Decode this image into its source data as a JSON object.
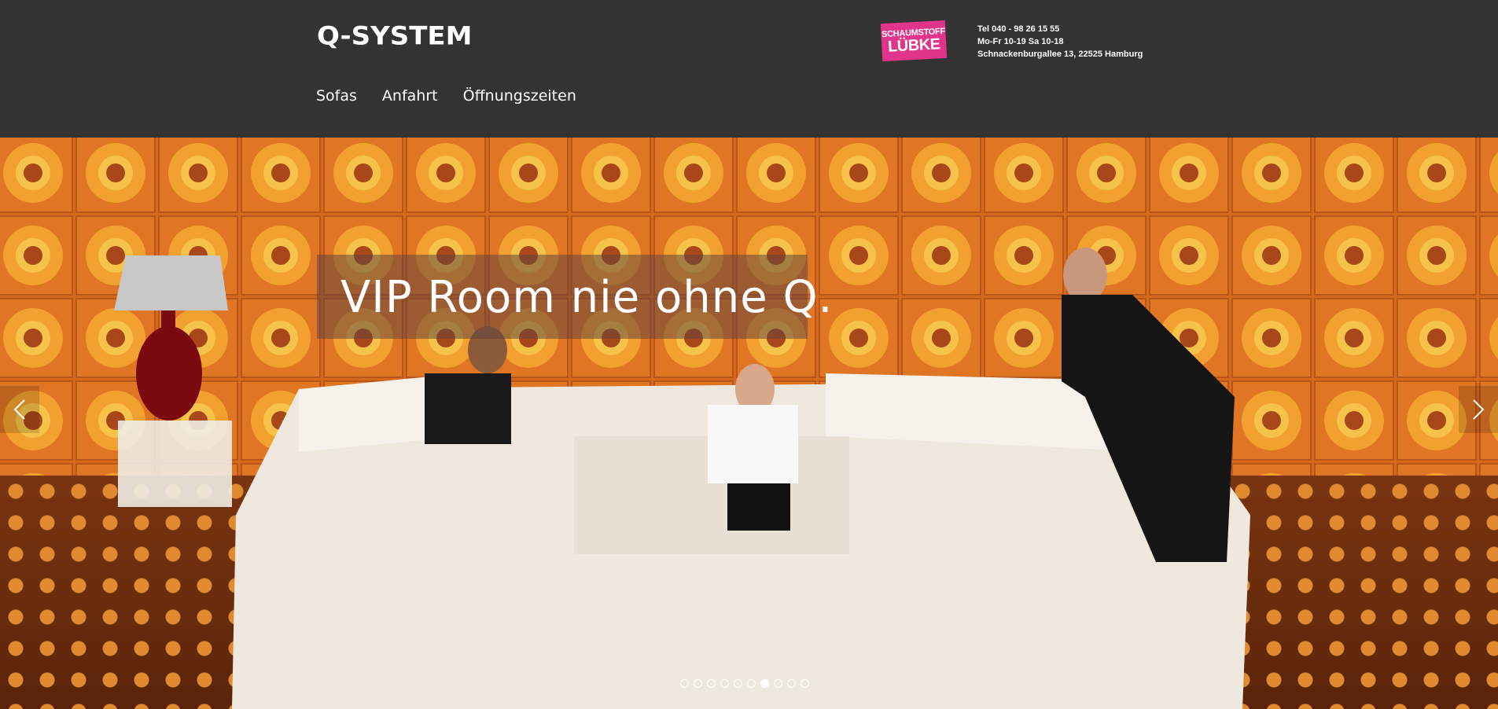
{
  "header": {
    "logo_text": "Q-SYSTEM",
    "partner_logo": {
      "line1": "SCHAUMSTOFF",
      "line2": "LÜBKE",
      "color": "#e0358b"
    },
    "contact": {
      "phone": "Tel 040 - 98 26 15 55",
      "hours": "Mo-Fr 10-19 Sa 10-18",
      "address": "Schnackenburgallee 13, 22525 Hamburg"
    },
    "nav": [
      {
        "label": "Sofas"
      },
      {
        "label": "Anfahrt"
      },
      {
        "label": "Öffnungszeiten"
      }
    ],
    "background": "#333333"
  },
  "hero": {
    "headline": "VIP Room nie ohne Q.",
    "prev_icon": "chevron-left-icon",
    "next_icon": "chevron-right-icon",
    "slide_count": 10,
    "active_slide": 7
  }
}
